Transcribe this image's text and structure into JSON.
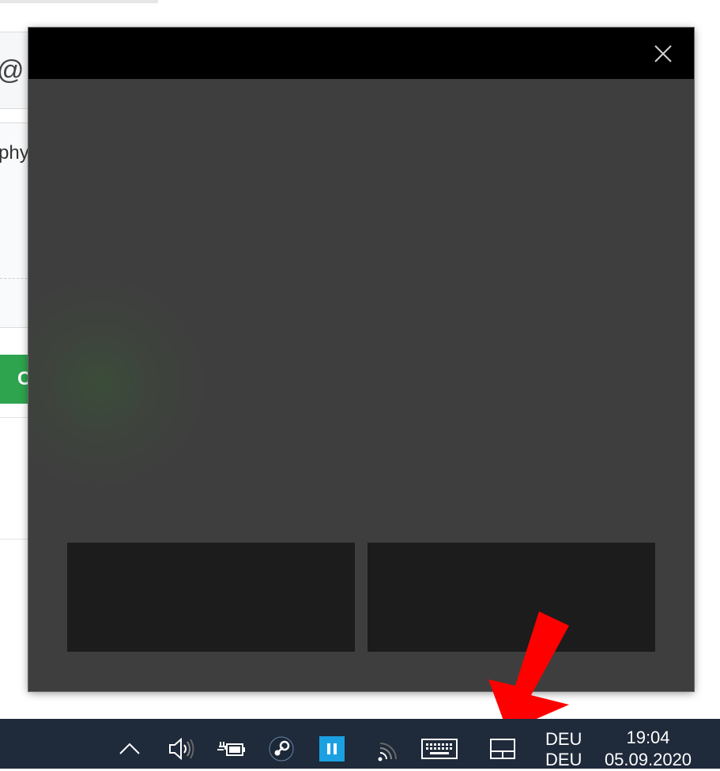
{
  "background_page": {
    "at_symbol": "@",
    "text_fragment": "phy",
    "green_button_fragment": "C"
  },
  "touchpad": {
    "close_icon": "close-icon",
    "left_button": "",
    "right_button": ""
  },
  "taskbar": {
    "tray_icons": [
      "chevron-up-icon",
      "speaker-icon",
      "battery-icon",
      "steam-icon",
      "pause-app-icon",
      "wifi-icon",
      "keyboard-icon",
      "touchpad-icon"
    ],
    "language": {
      "line1": "DEU",
      "line2": "DEU"
    },
    "clock": {
      "time": "19:04",
      "date": "05.09.2020"
    }
  },
  "colors": {
    "taskbar": "#1f2a3a",
    "flyout_titlebar": "#000000",
    "flyout_body": "#3e3e3e",
    "touchpad_buttons": "#1c1c1c",
    "annotation_arrow": "#ff0000",
    "accent_blue": "#1ba1e2"
  }
}
